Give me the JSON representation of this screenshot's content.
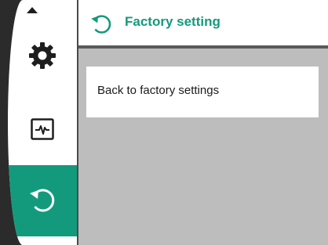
{
  "header": {
    "title": "Factory setting",
    "icon": "restore-icon"
  },
  "sidebar": {
    "scroll_up_icon": "chevron-up-icon",
    "items": [
      {
        "icon": "gear-icon",
        "active": false
      },
      {
        "icon": "diagnostics-icon",
        "active": false
      },
      {
        "icon": "restore-icon",
        "active": true
      }
    ]
  },
  "main": {
    "items": [
      {
        "label": "Back to factory settings"
      }
    ]
  },
  "colors": {
    "accent": "#139a7c",
    "content_background": "#bdbdbd",
    "bezel": "#2b2b2b"
  }
}
